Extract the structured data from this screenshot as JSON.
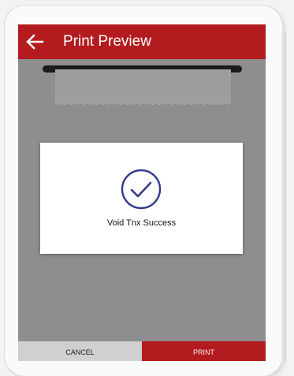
{
  "header": {
    "title": "Print Preview",
    "back_icon": "arrow-left-icon"
  },
  "dialog": {
    "icon": "check-circle-icon",
    "message": "Void Tnx Success"
  },
  "actions": {
    "cancel_label": "CANCEL",
    "print_label": "PRINT"
  },
  "colors": {
    "brand": "#b31b1f",
    "overlay": "#8e8e8e",
    "check": "#333a8a",
    "cancel_bg": "#d0d0d0"
  }
}
